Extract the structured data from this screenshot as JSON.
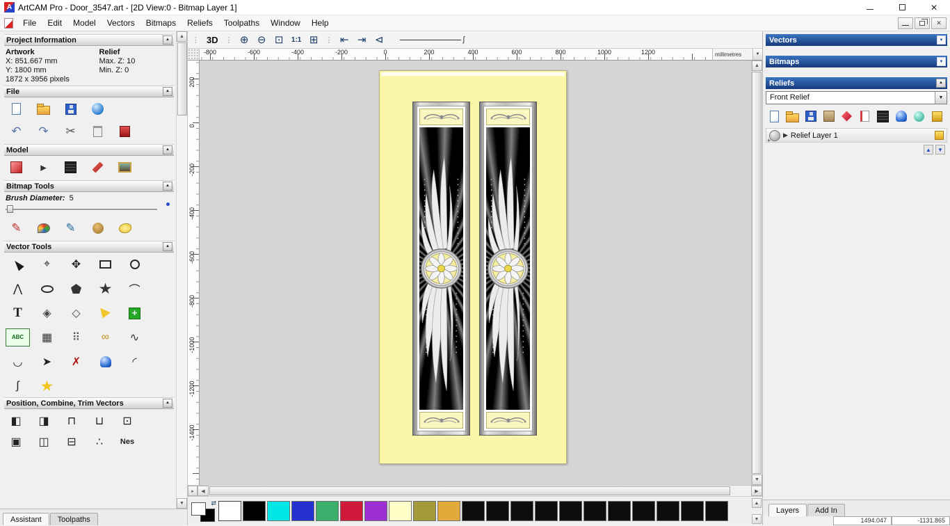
{
  "titlebar": {
    "title": "ArtCAM Pro - Door_3547.art - [2D View:0 - Bitmap Layer 1]"
  },
  "menubar": {
    "items": [
      "File",
      "Edit",
      "Model",
      "Vectors",
      "Bitmaps",
      "Reliefs",
      "Toolpaths",
      "Window",
      "Help"
    ]
  },
  "assistant": {
    "project": {
      "title": "Project Information",
      "artwork_label": "Artwork",
      "relief_label": "Relief",
      "artwork_x": "X: 851.667 mm",
      "artwork_y": "Y: 1800 mm",
      "artwork_pixels": "1872 x 3956 pixels",
      "relief_max_z": "Max. Z: 10",
      "relief_min_z": "Min. Z: 0"
    },
    "file": {
      "title": "File",
      "row1": [
        {
          "name": "new-model-icon",
          "shape": "page"
        },
        {
          "name": "open-model-icon",
          "shape": "folder"
        },
        {
          "name": "save-model-icon",
          "shape": "floppy"
        },
        {
          "name": "export-model-icon",
          "shape": "globe"
        }
      ],
      "row2": [
        {
          "name": "undo-icon",
          "glyph": "↶",
          "fg": "#5b74a8"
        },
        {
          "name": "redo-icon",
          "glyph": "↷",
          "fg": "#5b74a8"
        },
        {
          "name": "cut-icon",
          "glyph": "✂",
          "fg": "#555"
        },
        {
          "name": "paste-icon",
          "shape": "clipboard"
        },
        {
          "name": "notes-icon",
          "shape": "book"
        }
      ]
    },
    "model": {
      "title": "Model",
      "icons": [
        {
          "name": "set-model-size-icon",
          "shape": "model-red"
        },
        {
          "name": "model-arrow-icon",
          "glyph": "▸",
          "fg": "#333"
        },
        {
          "name": "greyscale-model-icon",
          "shape": "dark-grid"
        },
        {
          "name": "lighting-model-icon",
          "shape": "tool-red"
        },
        {
          "name": "load-image-icon",
          "shape": "picture"
        }
      ]
    },
    "bitmap_tools": {
      "title": "Bitmap Tools",
      "brush_label": "Brush Diameter:",
      "brush_value": "5",
      "icons": [
        {
          "name": "paint-brush-icon",
          "glyph": "✎",
          "fg": "#c03030"
        },
        {
          "name": "colour-palette-icon",
          "shape": "palette-sh"
        },
        {
          "name": "draw-brush-icon",
          "glyph": "✎",
          "fg": "#2a6a9a"
        },
        {
          "name": "colour-reduce-icon",
          "shape": "cookie"
        },
        {
          "name": "flood-fill-icon",
          "shape": "blob"
        }
      ]
    },
    "vector_tools": {
      "title": "Vector Tools",
      "tools": [
        {
          "name": "select-vectors-tool",
          "shape": "cursorshape"
        },
        {
          "name": "node-editing-tool",
          "glyph": "⌖"
        },
        {
          "name": "transform-vectors-tool",
          "glyph": "✥"
        },
        {
          "name": "create-rectangle-tool",
          "shape": "rect-o"
        },
        {
          "name": "create-circle-tool",
          "shape": "circle-o"
        },
        {
          "name": "create-polyline-tool",
          "glyph": "⋀"
        },
        {
          "name": "create-ellipse-tool",
          "shape": "ellipse-o"
        },
        {
          "name": "create-polygon-tool",
          "shape": "pent"
        },
        {
          "name": "create-star-tool",
          "shape": "star-dark"
        },
        {
          "name": "create-arc-tool",
          "glyph": "⌒"
        },
        {
          "name": "create-text-tool",
          "glyph": "T",
          "cls": "txt-T"
        },
        {
          "name": "measure-tool",
          "glyph": "◈",
          "fg": "#444"
        },
        {
          "name": "offset-vectors-tool",
          "glyph": "◇",
          "fg": "#444"
        },
        {
          "name": "slice-vectors-tool",
          "shape": "wedge"
        },
        {
          "name": "block-copy-tool",
          "shape": "cross-green"
        },
        {
          "name": "text-on-curve-tool",
          "label": "ABC",
          "cls": "abc",
          "fg": "#14691e"
        },
        {
          "name": "wrap-text-grid-tool",
          "glyph": "▦",
          "fg": "#333"
        },
        {
          "name": "block-paste-tool",
          "glyph": "⠿",
          "fg": "#555"
        },
        {
          "name": "chain-vectors-tool",
          "glyph": "∞",
          "fg": "#c29018"
        },
        {
          "name": "fit-curve-tool",
          "glyph": "∿",
          "fg": "#333"
        },
        {
          "name": "join-close-tool",
          "glyph": "◡"
        },
        {
          "name": "join-move-tool",
          "glyph": "➤"
        },
        {
          "name": "delete-span-tool",
          "glyph": "✗",
          "fg": "#b01010"
        },
        {
          "name": "interactive-sculpt-tool",
          "shape": "dome"
        },
        {
          "name": "fillet-tool",
          "glyph": "◜"
        },
        {
          "name": "section-profile-tool",
          "glyph": "∫"
        },
        {
          "name": "vector-doctor-tool",
          "shape": "star-gold"
        }
      ]
    },
    "position_section": {
      "title": "Position, Combine, Trim Vectors",
      "row1": [
        {
          "name": "align-left-icon",
          "glyph": "◧"
        },
        {
          "name": "align-right-icon",
          "glyph": "◨"
        },
        {
          "name": "align-top-icon",
          "glyph": "⊓"
        },
        {
          "name": "align-bottom-icon",
          "glyph": "⊔"
        },
        {
          "name": "align-centre-icon",
          "glyph": "⊡"
        }
      ],
      "row2": [
        {
          "name": "centre-in-page-icon",
          "glyph": "▣"
        },
        {
          "name": "paste-along-curve-icon",
          "glyph": "◫"
        },
        {
          "name": "block-combine-icon",
          "glyph": "⊟"
        },
        {
          "name": "scatter-copy-icon",
          "glyph": "∴"
        },
        {
          "name": "nest-vectors-label",
          "label": "Nes",
          "cls": "nes-label"
        }
      ]
    },
    "tabs": [
      {
        "label": "Assistant",
        "active": true
      },
      {
        "label": "Toolpaths",
        "active": false
      }
    ]
  },
  "view_toolbar": {
    "view3d_label": "3D",
    "zoom_buttons": [
      {
        "name": "zoom-in-button",
        "glyph": "⊕"
      },
      {
        "name": "zoom-out-button",
        "glyph": "⊖"
      },
      {
        "name": "zoom-window-button",
        "glyph": "⊡"
      },
      {
        "name": "zoom-1to1-button",
        "label": "1:1"
      },
      {
        "name": "zoom-fit-button",
        "glyph": "⊞"
      }
    ],
    "nav_buttons": [
      {
        "name": "previous-view-button",
        "glyph": "⇤"
      },
      {
        "name": "next-view-button",
        "glyph": "⇥"
      },
      {
        "name": "zoom-previous-button",
        "glyph": "⊲"
      }
    ]
  },
  "rulers": {
    "h_ticks": [
      "-800",
      "-600",
      "-400",
      "-200",
      "0",
      "200",
      "400",
      "600",
      "800",
      "1000",
      "1200"
    ],
    "v_ticks": [
      "200",
      "0",
      "-200",
      "-400",
      "-600",
      "-800",
      "-1000",
      "-1200",
      "-1400"
    ],
    "units": "millimetres"
  },
  "right_panel": {
    "vectors_title": "Vectors",
    "bitmaps_title": "Bitmaps",
    "reliefs_title": "Reliefs",
    "relief_name": "Front Relief",
    "relief_icons": [
      {
        "name": "new-relief-icon",
        "shape": "page"
      },
      {
        "name": "open-relief-icon",
        "shape": "folder"
      },
      {
        "name": "save-relief-icon",
        "shape": "floppy"
      },
      {
        "name": "paste-relief-icon",
        "shape": "tan-sq"
      },
      {
        "name": "smooth-relief-icon",
        "shape": "red-gem"
      },
      {
        "name": "invert-relief-icon",
        "shape": "white-page"
      },
      {
        "name": "greyscale-relief-icon",
        "shape": "dark-grid"
      },
      {
        "name": "sculpt-relief-icon",
        "shape": "dome"
      },
      {
        "name": "glass-relief-icon",
        "shape": "teal-ball"
      },
      {
        "name": "lock-relief-icon",
        "shape": "gold-sq"
      }
    ],
    "layer": {
      "name": "Relief Layer 1"
    },
    "tabs": [
      {
        "label": "Layers",
        "active": true
      },
      {
        "label": "Add In",
        "active": false
      }
    ],
    "status_cells": [
      "1494.047",
      "-1131.865"
    ]
  },
  "palette": {
    "colors": [
      "#ffffff",
      "#000000",
      "#00e6e6",
      "#2431cf",
      "#3aae6b",
      "#d01a3c",
      "#9c2fd0",
      "#ffffc8",
      "#a39a39",
      "#e2a93b",
      "#0d0d0d",
      "#0d0d0d",
      "#0d0d0d",
      "#0d0d0d",
      "#0d0d0d",
      "#0d0d0d",
      "#0d0d0d",
      "#0d0d0d",
      "#0d0d0d",
      "#0d0d0d",
      "#0d0d0d"
    ]
  },
  "canvas": {
    "page_color": "#faf7a8",
    "band_color": "#fbf7c0",
    "medallion_color": "#f4eda2"
  }
}
